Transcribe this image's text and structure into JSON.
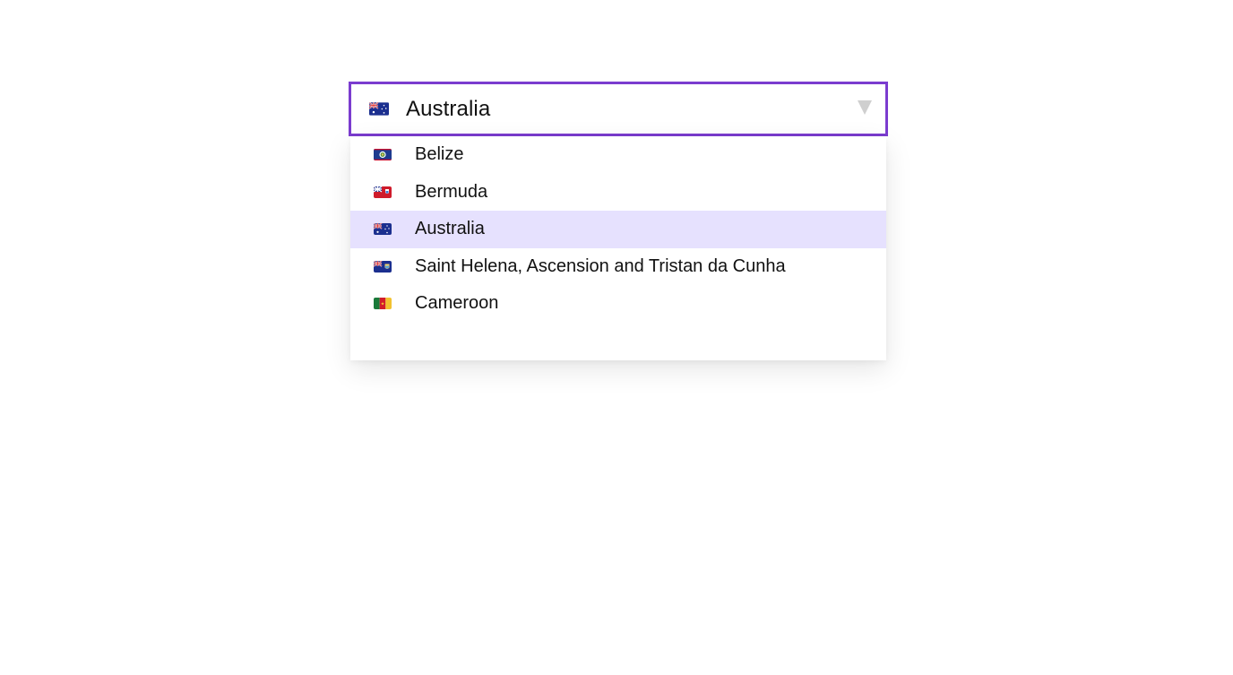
{
  "select": {
    "value": "Australia",
    "value_flag": "australia-flag",
    "caret_icon": "triangle-down-icon",
    "border_color": "#7b3ccf"
  },
  "menu": {
    "selected_bg": "#e6e1fe",
    "options": [
      {
        "label": "Belize",
        "flag": "belize-flag",
        "selected": false
      },
      {
        "label": "Bermuda",
        "flag": "bermuda-flag",
        "selected": false
      },
      {
        "label": "Australia",
        "flag": "australia-flag",
        "selected": true
      },
      {
        "label": "Saint Helena, Ascension and Tristan da Cunha",
        "flag": "saint-helena-flag",
        "selected": false
      },
      {
        "label": "Cameroon",
        "flag": "cameroon-flag",
        "selected": false
      }
    ]
  }
}
